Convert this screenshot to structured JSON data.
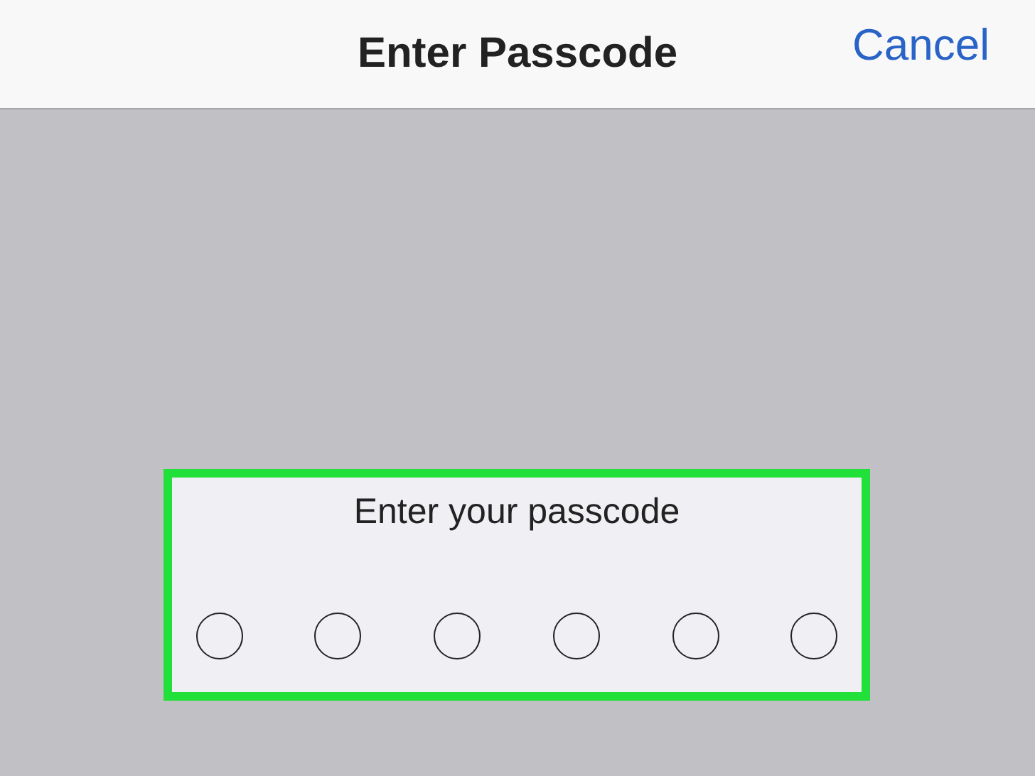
{
  "nav_bar": {
    "title": "Enter Passcode",
    "cancel": "Cancel"
  },
  "passcode_panel": {
    "highlighted": true,
    "prompt": "Enter your passcode",
    "digits": [
      {
        "filled": false
      },
      {
        "filled": false
      },
      {
        "filled": false
      },
      {
        "filled": false
      },
      {
        "filled": false
      },
      {
        "filled": false
      }
    ]
  }
}
